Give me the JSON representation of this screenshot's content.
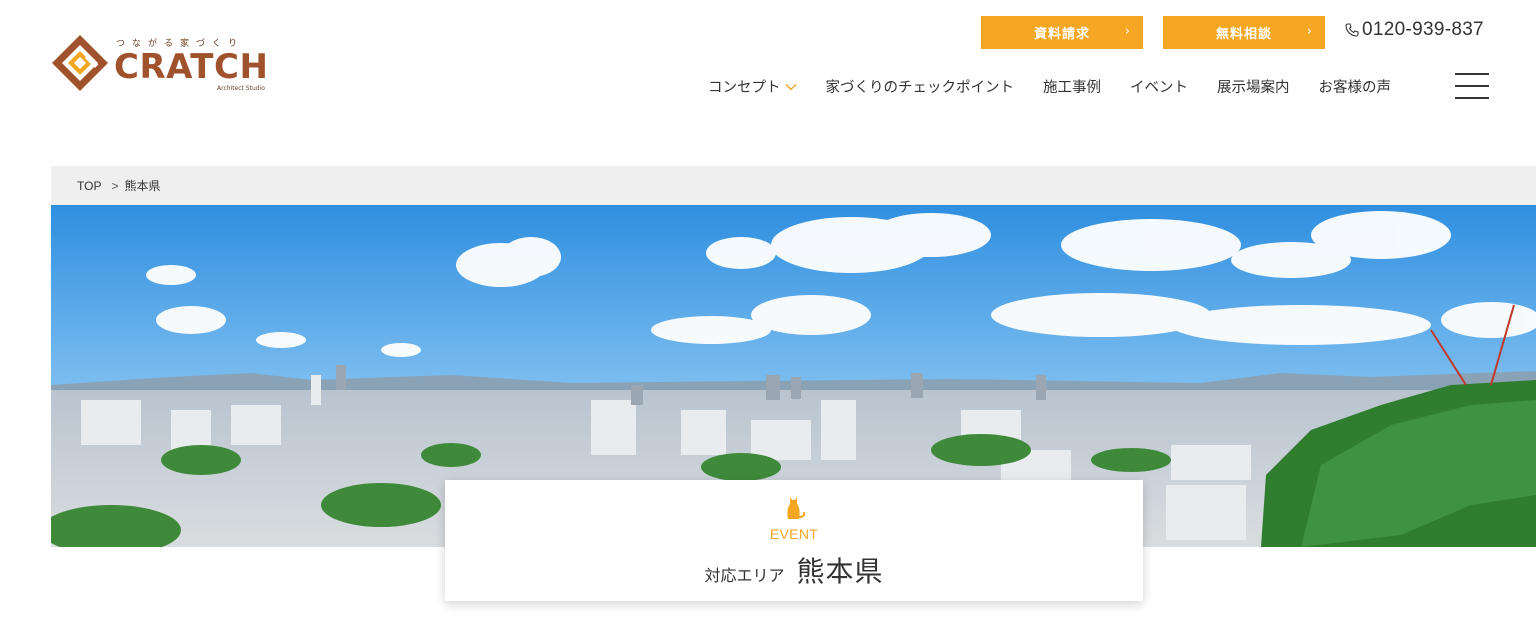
{
  "header": {
    "logo": {
      "tagline": "つながる家づくり",
      "wordmark": "CRATCH",
      "sub": "Architect Studio"
    },
    "cta_buttons": [
      {
        "label": "資料請求",
        "icon": "chevron-right-icon"
      },
      {
        "label": "無料相談",
        "icon": "chevron-right-icon"
      }
    ],
    "phone": {
      "icon": "phone-icon",
      "number": "0120-939-837"
    },
    "nav": [
      {
        "label": "コンセプト",
        "has_dropdown": true
      },
      {
        "label": "家づくりのチェックポイント"
      },
      {
        "label": "施工事例"
      },
      {
        "label": "イベント"
      },
      {
        "label": "展示場案内"
      },
      {
        "label": "お客様の声"
      }
    ],
    "menu_icon": "hamburger-menu-icon"
  },
  "breadcrumb": {
    "items": [
      "TOP",
      "熊本県"
    ],
    "separator": ">"
  },
  "hero": {
    "image": "city-skyline-panorama"
  },
  "title_card": {
    "icon": "cat-silhouette-icon",
    "eyebrow": "EVENT",
    "prefix": "対応エリア",
    "title": "熊本県"
  },
  "colors": {
    "accent": "#f5a623",
    "brand_brown": "#a0522d",
    "breadcrumb_bg": "#efefef",
    "text": "#333333"
  }
}
